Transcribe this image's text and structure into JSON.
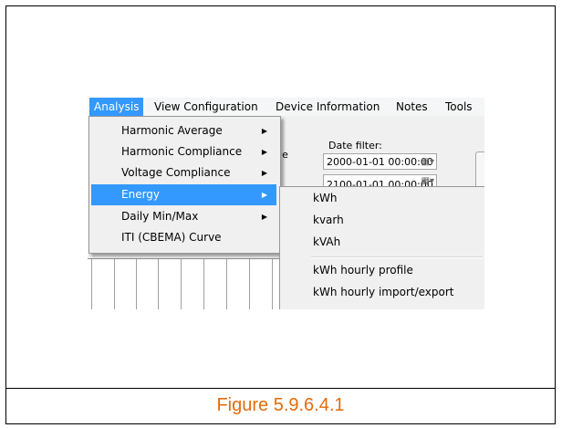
{
  "menubar": {
    "items": [
      "Analysis",
      "View Configuration",
      "Device Information",
      "Notes",
      "Tools"
    ]
  },
  "background": {
    "table_label": "table",
    "date_filter_label": "Date filter:",
    "date_from": "2000-01-01 00:00:00",
    "date_to": "2100-01-01 00:00:00"
  },
  "analysis_menu": {
    "items": [
      {
        "label": "Harmonic Average",
        "has_submenu": true
      },
      {
        "label": "Harmonic Compliance",
        "has_submenu": true
      },
      {
        "label": "Voltage Compliance",
        "has_submenu": true
      },
      {
        "label": "Energy",
        "has_submenu": true,
        "highlighted": true
      },
      {
        "label": "Daily Min/Max",
        "has_submenu": true
      },
      {
        "label": "ITI (CBEMA) Curve",
        "has_submenu": false
      }
    ]
  },
  "energy_submenu": {
    "items": [
      "kWh",
      "kvarh",
      "kVAh",
      "kWh hourly profile",
      "kWh hourly import/export"
    ]
  },
  "caption": "Figure 5.9.6.4.1",
  "colors": {
    "highlight": "#3399ff",
    "caption": "#e36c09"
  },
  "icons": {
    "submenu_arrow": "triangle-right",
    "calendar": "calendar-dropdown"
  }
}
